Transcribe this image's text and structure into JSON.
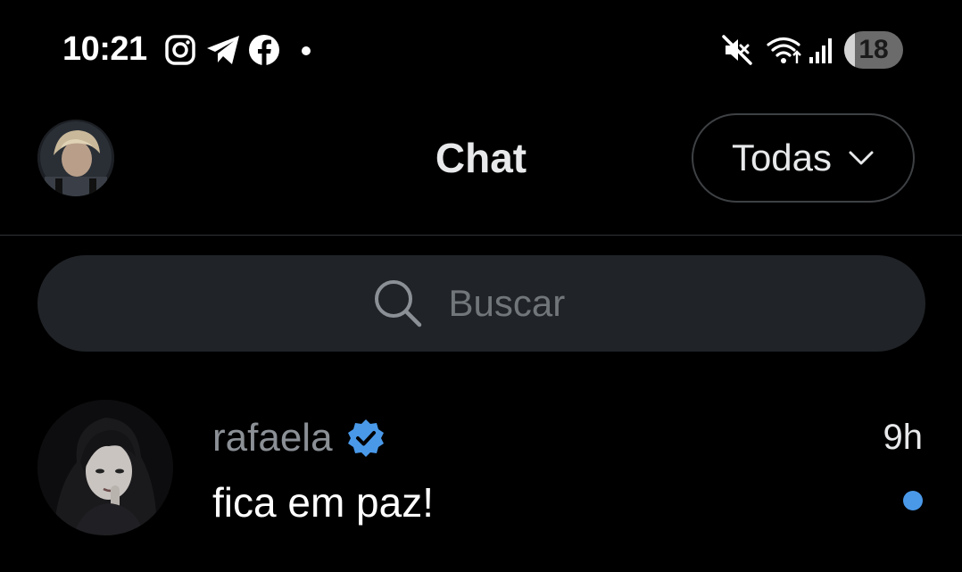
{
  "status_bar": {
    "time": "10:21",
    "notification_icons": [
      "instagram-icon",
      "telegram-icon",
      "facebook-icon"
    ],
    "system_icons": [
      "mute-icon",
      "wifi-icon",
      "signal-icon"
    ],
    "battery": "18",
    "battery_level": 0.18
  },
  "header": {
    "title": "Chat",
    "filter_label": "Todas"
  },
  "search": {
    "placeholder": "Buscar"
  },
  "conversations": [
    {
      "name": "rafaela",
      "verified": true,
      "last_message": "fica em paz!",
      "time": "9h",
      "unread": true
    }
  ],
  "colors": {
    "background": "#000000",
    "accent": "#4a99e9",
    "search_bg": "#202327",
    "divider": "#2f3336",
    "muted_text": "#71767b"
  }
}
